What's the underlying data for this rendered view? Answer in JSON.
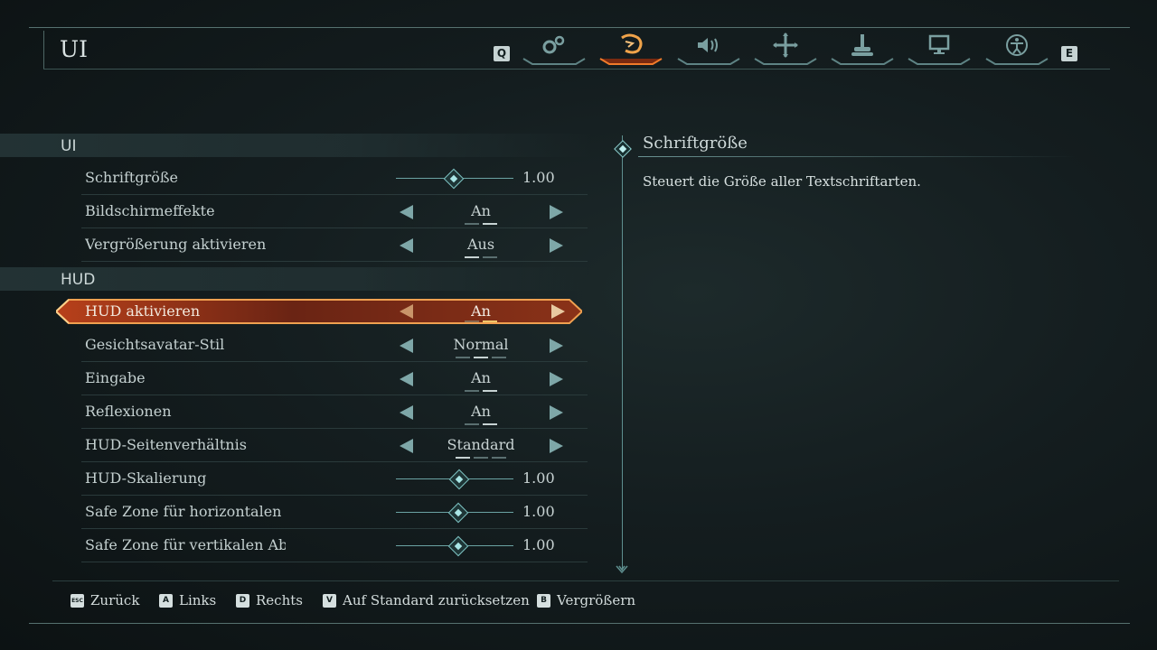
{
  "page": {
    "title": "UI"
  },
  "tabs": {
    "prev_key": "Q",
    "next_key": "E",
    "items": [
      {
        "icon": "gears-icon",
        "active": false
      },
      {
        "icon": "dragon-icon",
        "active": true
      },
      {
        "icon": "speaker-icon",
        "active": false
      },
      {
        "icon": "dpad-icon",
        "active": false
      },
      {
        "icon": "joystick-icon",
        "active": false
      },
      {
        "icon": "monitor-icon",
        "active": false
      },
      {
        "icon": "accessibility-icon",
        "active": false
      }
    ]
  },
  "sections": {
    "ui": {
      "label": "UI"
    },
    "hud": {
      "label": "HUD"
    }
  },
  "settings": {
    "font_size": {
      "label": "Schriftgröße",
      "value": "1.00",
      "level": 0.5
    },
    "screen_effects": {
      "label": "Bildschirmeffekte",
      "value": "An",
      "options": 2,
      "index": 1
    },
    "magnification": {
      "label": "Vergrößerung aktivieren",
      "value": "Aus",
      "options": 2,
      "index": 0
    },
    "hud_enable": {
      "label": "HUD aktivieren",
      "value": "An",
      "options": 2,
      "index": 1
    },
    "face_avatar": {
      "label": "Gesichtsavatar-Stil",
      "value": "Normal",
      "options": 3,
      "index": 1
    },
    "input": {
      "label": "Eingabe",
      "value": "An",
      "options": 2,
      "index": 1
    },
    "reflections": {
      "label": "Reflexionen",
      "value": "An",
      "options": 2,
      "index": 1
    },
    "hud_ratio": {
      "label": "HUD-Seitenverhältnis",
      "value": "Standard",
      "options": 3,
      "index": 0
    },
    "hud_scale": {
      "label": "HUD-Skalierung",
      "value": "1.00",
      "level": 0.5
    },
    "safe_h": {
      "label": "Safe Zone für horizontalen Ab",
      "value": "1.00",
      "level": 0.5
    },
    "safe_v": {
      "label": "Safe Zone für vertikalen Absta",
      "value": "1.00",
      "level": 0.5
    }
  },
  "description": {
    "title": "Schriftgröße",
    "text": "Steuert die Größe aller Textschriftarten."
  },
  "footer": {
    "back": {
      "key": "ESC",
      "label": "Zurück"
    },
    "left": {
      "key": "A",
      "label": "Links"
    },
    "right": {
      "key": "D",
      "label": "Rechts"
    },
    "reset": {
      "key": "V",
      "label": "Auf Standard zurücksetzen"
    },
    "zoom": {
      "key": "B",
      "label": "Vergrößern"
    }
  },
  "colors": {
    "accent_cyan": "#7cc0c0",
    "selection_orange": "#e0622a",
    "selection_glow": "#f0a050"
  }
}
